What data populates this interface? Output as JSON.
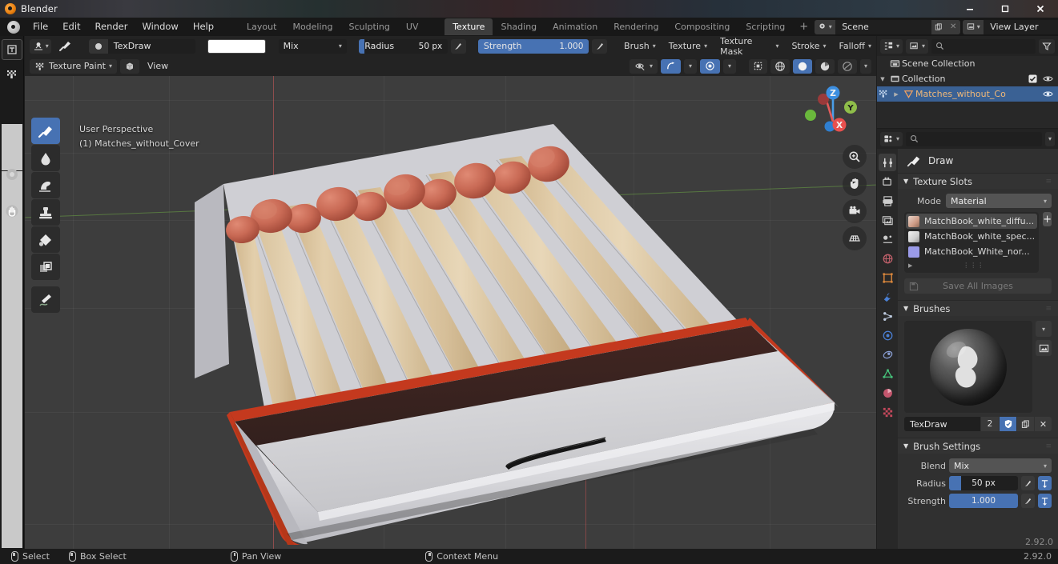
{
  "window": {
    "title": "Blender",
    "controls": [
      "minimize",
      "maximize",
      "close"
    ]
  },
  "topbar": {
    "menus": [
      "File",
      "Edit",
      "Render",
      "Window",
      "Help"
    ],
    "workspaces": [
      {
        "label": "Layout",
        "active": false
      },
      {
        "label": "Modeling",
        "active": false
      },
      {
        "label": "Sculpting",
        "active": false
      },
      {
        "label": "UV Editing",
        "active": false
      },
      {
        "label": "Texture Paint",
        "active": true
      },
      {
        "label": "Shading",
        "active": false
      },
      {
        "label": "Animation",
        "active": false
      },
      {
        "label": "Rendering",
        "active": false
      },
      {
        "label": "Compositing",
        "active": false
      },
      {
        "label": "Scripting",
        "active": false
      }
    ],
    "add_workspace": "+",
    "scene_name": "Scene",
    "view_layer_name": "View Layer"
  },
  "tool_header": {
    "mode_label": "Texture Paint",
    "brush_name": "TexDraw",
    "color_hex": "#ffffff",
    "blend_mode": "Mix",
    "radius_label": "Radius",
    "radius_value": "50 px",
    "radius_fill_pct": 6,
    "strength_label": "Strength",
    "strength_value": "1.000",
    "strength_fill_pct": 100,
    "menus": [
      "Brush",
      "Texture",
      "Texture Mask",
      "Stroke",
      "Falloff"
    ]
  },
  "viewport_header": {
    "mode": "Texture Paint",
    "view_menu": "View",
    "shading_modes": [
      "wireframe",
      "solid",
      "material-preview",
      "rendered"
    ],
    "active_shading": "solid"
  },
  "viewport": {
    "perspective_label": "User Perspective",
    "object_label": "(1) Matches_without_Cover",
    "gizmo_axes": [
      "X",
      "Y",
      "Z"
    ],
    "tools": [
      {
        "name": "draw",
        "active": true
      },
      {
        "name": "soften",
        "active": false
      },
      {
        "name": "smear",
        "active": false
      },
      {
        "name": "clone",
        "active": false
      },
      {
        "name": "fill",
        "active": false
      },
      {
        "name": "mask",
        "active": false
      },
      {
        "name": "annotate",
        "active": false
      }
    ],
    "nav_buttons": [
      "zoom",
      "move",
      "camera",
      "orthographic"
    ]
  },
  "outliner": {
    "search_placeholder": "",
    "rows": [
      {
        "label": "Scene Collection",
        "indent": 0,
        "selected": false,
        "has_expand": false,
        "has_checkbox": false,
        "has_eye": false,
        "icon": "collection-icon"
      },
      {
        "label": "Collection",
        "indent": 1,
        "selected": false,
        "has_expand": true,
        "has_checkbox": true,
        "has_eye": true,
        "icon": "collection-icon"
      },
      {
        "label": "Matches_without_Co",
        "indent": 2,
        "selected": true,
        "has_expand": true,
        "has_checkbox": false,
        "has_eye": true,
        "icon": "mesh-icon"
      }
    ]
  },
  "properties": {
    "search_placeholder": "",
    "tabs": [
      {
        "name": "tool",
        "active": true
      },
      {
        "name": "render",
        "active": false
      },
      {
        "name": "output",
        "active": false
      },
      {
        "name": "view-layer",
        "active": false
      },
      {
        "name": "scene",
        "active": false
      },
      {
        "name": "world",
        "active": false
      },
      {
        "name": "object",
        "active": false
      },
      {
        "name": "modifiers",
        "active": false
      },
      {
        "name": "particles",
        "active": false
      },
      {
        "name": "physics",
        "active": false
      },
      {
        "name": "constraints",
        "active": false
      },
      {
        "name": "object-data",
        "active": false
      },
      {
        "name": "material",
        "active": false
      },
      {
        "name": "texture",
        "active": false
      }
    ],
    "brush_title": "Draw",
    "texture_slots": {
      "panel_title": "Texture Slots",
      "mode_label": "Mode",
      "mode_value": "Material",
      "slots": [
        {
          "label": "MatchBook_white_diffu...",
          "selected": true,
          "swatch": "#d8b4a4"
        },
        {
          "label": "MatchBook_white_spec...",
          "selected": false,
          "swatch": "#e8e8e8"
        },
        {
          "label": "MatchBook_White_nor...",
          "selected": false,
          "swatch": "#8f8fe8"
        }
      ],
      "add_label": "+",
      "save_all_label": "Save All Images"
    },
    "brushes": {
      "panel_title": "Brushes",
      "brush_name": "TexDraw",
      "users_count": "2",
      "fake_user_on": true
    },
    "brush_settings": {
      "panel_title": "Brush Settings",
      "blend_label": "Blend",
      "blend_value": "Mix",
      "radius_label": "Radius",
      "radius_value": "50 px",
      "radius_fill_pct": 18,
      "strength_label": "Strength",
      "strength_value": "1.000",
      "strength_fill_pct": 100
    },
    "version_badge": "2.92.0"
  },
  "statusbar": {
    "items": [
      {
        "label": "Select",
        "mouse": "left"
      },
      {
        "label": "Box Select",
        "mouse": "left-drag"
      },
      {
        "label": "Pan View",
        "mouse": "middle"
      },
      {
        "label": "Context Menu",
        "mouse": "right"
      }
    ],
    "version": "2.92.0"
  },
  "colors": {
    "accent_blue": "#4772b3",
    "selected_row": "#3a6194",
    "viewport_bg": "#3d3d3d",
    "panel_bg": "#303030",
    "header_bg": "#232323",
    "match_head": "#c8604f",
    "match_stick": "#d9c29c",
    "box_white": "#d2d2d4",
    "strike_strip": "#3d2320",
    "box_red_edge": "#c4391e"
  }
}
